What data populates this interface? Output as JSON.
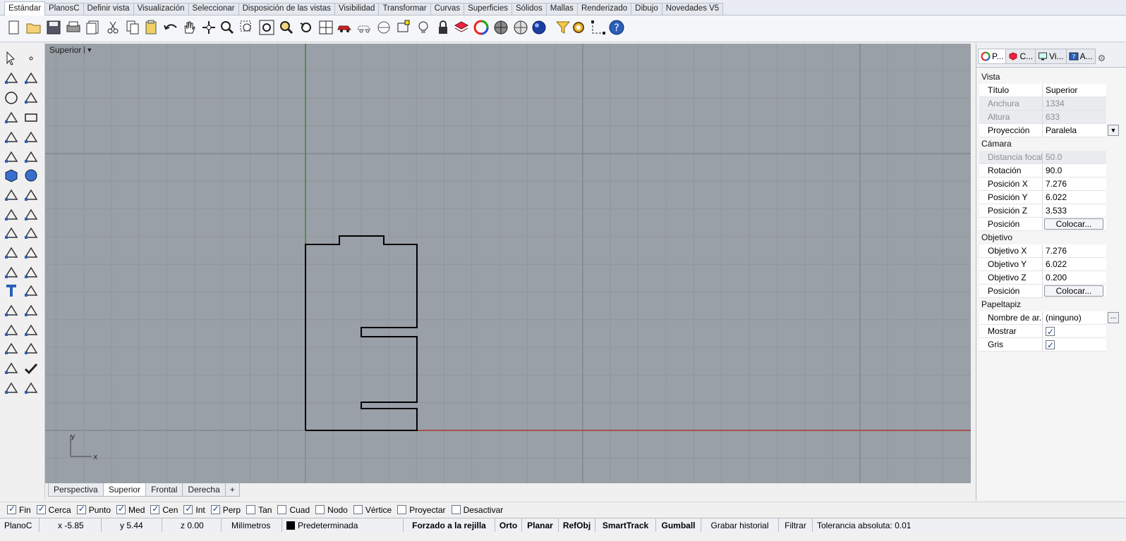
{
  "menu_tabs": [
    "Estándar",
    "PlanosC",
    "Definir vista",
    "Visualización",
    "Seleccionar",
    "Disposición de las vistas",
    "Visibilidad",
    "Transformar",
    "Curvas",
    "Superficies",
    "Sólidos",
    "Mallas",
    "Renderizado",
    "Dibujo",
    "Novedades V5"
  ],
  "active_menu_tab": "Estándar",
  "viewport": {
    "title": "Superior",
    "axis_y": "y",
    "axis_x": "x"
  },
  "viewport_tabs": [
    "Perspectiva",
    "Superior",
    "Frontal",
    "Derecha"
  ],
  "active_viewport_tab": "Superior",
  "osnaps": [
    {
      "label": "Fin",
      "checked": true
    },
    {
      "label": "Cerca",
      "checked": true
    },
    {
      "label": "Punto",
      "checked": true
    },
    {
      "label": "Med",
      "checked": true
    },
    {
      "label": "Cen",
      "checked": true
    },
    {
      "label": "Int",
      "checked": true
    },
    {
      "label": "Perp",
      "checked": true
    },
    {
      "label": "Tan",
      "checked": false
    },
    {
      "label": "Cuad",
      "checked": false
    },
    {
      "label": "Nodo",
      "checked": false
    },
    {
      "label": "Vértice",
      "checked": false
    },
    {
      "label": "Proyectar",
      "checked": false
    },
    {
      "label": "Desactivar",
      "checked": false
    }
  ],
  "status": {
    "cplane": "PlanoC",
    "x": "x -5.85",
    "y": "y 5.44",
    "z": "z 0.00",
    "units": "Milímetros",
    "layer": "Predeterminada",
    "grid_snap": "Forzado a la rejilla",
    "ortho": "Orto",
    "planar": "Planar",
    "osnap": "RefObj",
    "smarttrack": "SmartTrack",
    "gumball": "Gumball",
    "history": "Grabar historial",
    "filter": "Filtrar",
    "tolerance": "Tolerancia absoluta: 0.01"
  },
  "panel": {
    "tabs": [
      "P...",
      "C...",
      "Vi...",
      "A..."
    ],
    "sections": {
      "vista": "Vista",
      "camara": "Cámara",
      "objetivo": "Objetivo",
      "papeltapiz": "Papeltapiz"
    },
    "rows": {
      "titulo": {
        "k": "Título",
        "v": "Superior"
      },
      "anchura": {
        "k": "Anchura",
        "v": "1334"
      },
      "altura": {
        "k": "Altura",
        "v": "633"
      },
      "proyeccion": {
        "k": "Proyección",
        "v": "Paralela"
      },
      "distancia": {
        "k": "Distancia focal",
        "v": "50.0"
      },
      "rotacion": {
        "k": "Rotación",
        "v": "90.0"
      },
      "posx": {
        "k": "Posición X",
        "v": "7.276"
      },
      "posy": {
        "k": "Posición Y",
        "v": "6.022"
      },
      "posz": {
        "k": "Posición Z",
        "v": "3.533"
      },
      "posicion": {
        "k": "Posición",
        "v": "Colocar..."
      },
      "objx": {
        "k": "Objetivo X",
        "v": "7.276"
      },
      "objy": {
        "k": "Objetivo Y",
        "v": "6.022"
      },
      "objz": {
        "k": "Objetivo Z",
        "v": "0.200"
      },
      "objpos": {
        "k": "Posición",
        "v": "Colocar..."
      },
      "nombre": {
        "k": "Nombre de ar...",
        "v": "(ninguno)"
      },
      "mostrar": {
        "k": "Mostrar",
        "checked": true
      },
      "gris": {
        "k": "Gris",
        "checked": true
      }
    }
  }
}
